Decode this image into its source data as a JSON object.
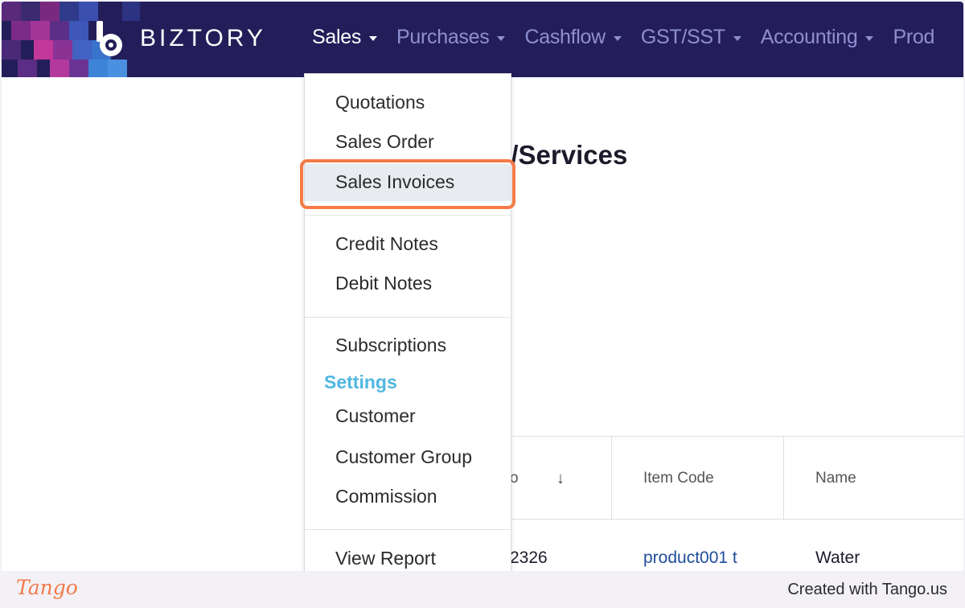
{
  "app": {
    "name": "BIZTORY"
  },
  "nav": {
    "items": [
      {
        "label": "Sales",
        "active": true
      },
      {
        "label": "Purchases",
        "active": false
      },
      {
        "label": "Cashflow",
        "active": false
      },
      {
        "label": "GST/SST",
        "active": false
      },
      {
        "label": "Accounting",
        "active": false
      },
      {
        "label": "Prod",
        "active": false
      }
    ]
  },
  "page": {
    "heading": "s/Services"
  },
  "sales_menu": {
    "group1": [
      "Quotations",
      "Sales Order",
      "Sales Invoices"
    ],
    "highlighted": "Sales Invoices",
    "group2": [
      "Credit Notes",
      "Debit Notes"
    ],
    "group3": [
      "Subscriptions"
    ],
    "settings_header": "Settings",
    "settings": [
      "Customer",
      "Customer Group",
      "Commission"
    ],
    "group4": [
      "View Report"
    ]
  },
  "table": {
    "headers": [
      "o",
      "Item Code",
      "Name"
    ],
    "sort_icon": "arrow-down-icon",
    "rows": [
      {
        "col0": "2326",
        "item_code": "product001 t",
        "name": "Water"
      }
    ]
  },
  "footer": {
    "brand": "Tango",
    "credit": "Created with Tango.us"
  },
  "colors": {
    "navbar": "#231e5a",
    "nav_active": "#ffffff",
    "nav_inactive": "#8f8fd0",
    "settings_header": "#4fb7e0",
    "highlight_ring": "#f47b46",
    "link": "#1f4d9c"
  }
}
